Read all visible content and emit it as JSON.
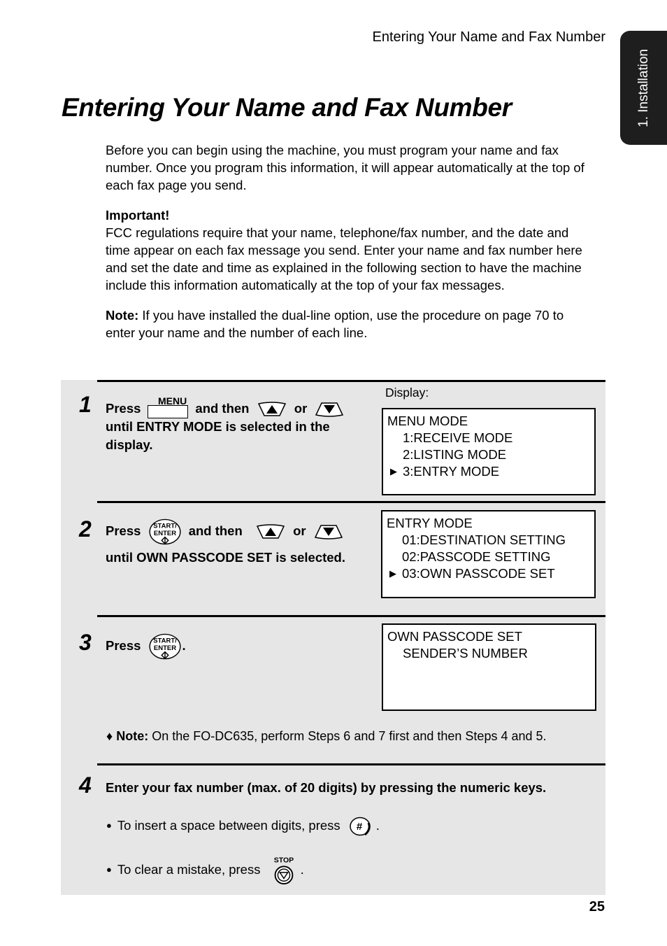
{
  "header": {
    "running_title": "Entering Your Name and Fax Number",
    "side_tab": "1. Installation"
  },
  "title": "Entering Your Name and Fax Number",
  "intro": {
    "para1": "Before you can begin using the machine, you must program your name and fax number. Once you program this information, it will appear automatically at the top of each fax page you send.",
    "important_label": "Important!",
    "important_text": "FCC regulations require that your name, telephone/fax number, and the date and time appear on each fax message you send. Enter your name and fax number here and set the date and time as explained in the following section to have the machine include this information automatically at the top of your fax messages.",
    "note_label": "Note:",
    "note_text": " If you have installed the dual-line option, use the procedure on page 70 to enter your name and the number of each line."
  },
  "display_label": "Display:",
  "keys": {
    "menu": "MENU",
    "start_line1": "START/",
    "start_line2": "ENTER",
    "stop": "STOP",
    "hash": "#"
  },
  "steps": [
    {
      "number": "1",
      "press": "Press",
      "and_then": "and then",
      "or": "or",
      "line2": "until ENTRY MODE is selected in the",
      "line3": "display.",
      "lcd": [
        "MENU MODE",
        "1:RECEIVE MODE",
        "2:LISTING MODE",
        "3:ENTRY MODE"
      ]
    },
    {
      "number": "2",
      "press": "Press",
      "and_then": "and then",
      "or": "or",
      "line2": "until OWN PASSCODE SET is selected.",
      "lcd": [
        "ENTRY MODE",
        "01:DESTINATION SETTING",
        "02:PASSCODE SETTING",
        "03:OWN PASSCODE SET"
      ]
    },
    {
      "number": "3",
      "press": "Press",
      "period": ".",
      "lcd": [
        "OWN PASSCODE SET",
        "SENDER’S NUMBER"
      ],
      "note_label": "Note:",
      "note_text": " On the FO-DC635, perform Steps 6 and 7 first and then Steps 4 and 5."
    },
    {
      "number": "4",
      "text": "Enter your fax number (max. of 20 digits) by pressing the numeric keys.",
      "bullet1": "To insert  a space between digits, press",
      "bullet2": "To clear a mistake, press",
      "period": "."
    }
  ],
  "pointer_glyph": "▶",
  "bullet_glyph": "●",
  "diamond_glyph": "♦",
  "page_number": "25"
}
